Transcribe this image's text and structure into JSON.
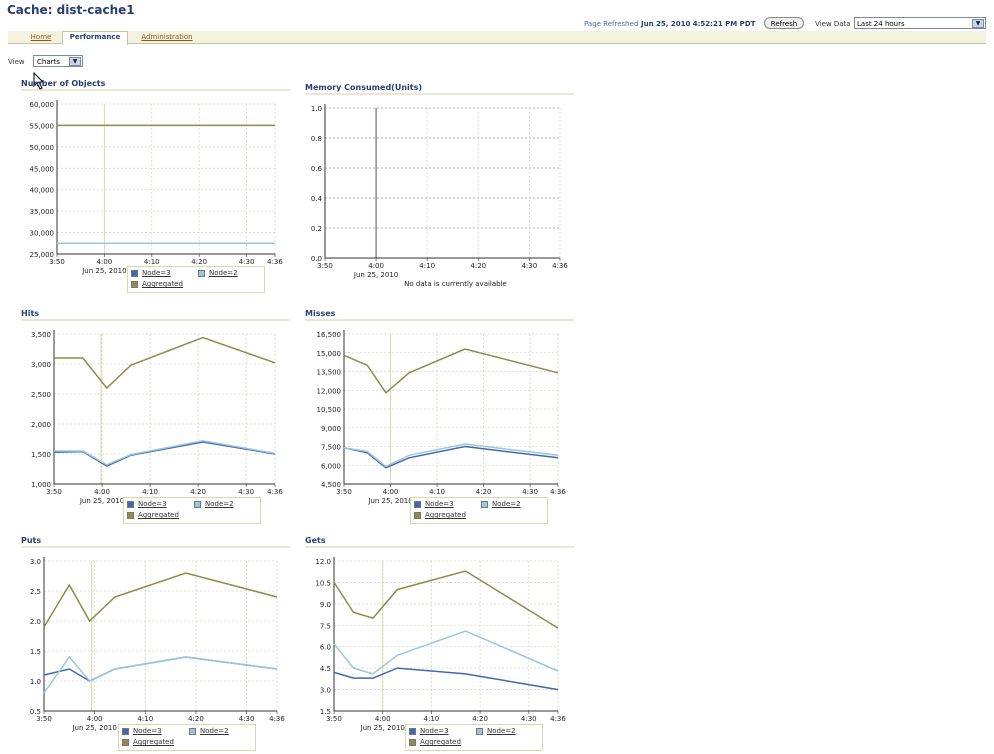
{
  "page_title": "Cache: dist-cache1",
  "header": {
    "refreshed_label": "Page Refreshed",
    "refreshed_time": "Jun 25, 2010 4:52:21 PM PDT",
    "refresh_button": "Refresh",
    "view_data_label": "View Data",
    "view_data_value": "Last 24 hours"
  },
  "tabs": [
    {
      "label": "Home"
    },
    {
      "label": "Performance"
    },
    {
      "label": "Administration"
    }
  ],
  "view": {
    "label": "View",
    "value": "Charts"
  },
  "colors": {
    "node3": "#3f67b5",
    "node2": "#9cc7da",
    "aggregated": "#8e8c48"
  },
  "legend": {
    "node3": "Node=3",
    "node2": "Node=2",
    "aggregated": "Aggregated"
  },
  "chart_data": [
    {
      "type": "line",
      "title": "Number of Objects",
      "x": [
        "3:50",
        "4:00",
        "4:10",
        "4:20",
        "4:30",
        "4:36"
      ],
      "x_date": "Jun 25, 2010",
      "yticks": [
        "60,000",
        "55,000",
        "50,000",
        "45,000",
        "40,000",
        "35,000",
        "30,000",
        "25,000"
      ],
      "ylim": [
        25000,
        60000
      ],
      "series": [
        {
          "name": "Node=3",
          "points": [
            [
              0,
              27500
            ],
            [
              46,
              27500
            ]
          ]
        },
        {
          "name": "Node=2",
          "points": [
            [
              0,
              27500
            ],
            [
              46,
              27500
            ]
          ]
        },
        {
          "name": "Aggregated",
          "points": [
            [
              0,
              55000
            ],
            [
              46,
              55000
            ]
          ]
        }
      ]
    },
    {
      "type": "line",
      "title": "Memory Consumed(Units)",
      "x": [
        "3:50",
        "4:00",
        "4:10",
        "4:20",
        "4:30",
        "4:36"
      ],
      "x_date": "Jun 25, 2010",
      "yticks": [
        "1.0",
        "0.8",
        "0.6",
        "0.4",
        "0.2",
        "0.0"
      ],
      "ylim": [
        0,
        1
      ],
      "no_data": "No data is currently available",
      "series": []
    },
    {
      "type": "line",
      "title": "Hits",
      "x": [
        "3:50",
        "4:00",
        "4:10",
        "4:20",
        "4:30",
        "4:36"
      ],
      "x_date": "Jun 25, 2010",
      "yticks": [
        "3,500",
        "3,000",
        "2,500",
        "2,000",
        "1,500",
        "1,000"
      ],
      "ylim": [
        1000,
        3500
      ],
      "series": [
        {
          "name": "Node=3",
          "points": [
            [
              0,
              1530
            ],
            [
              6,
              1540
            ],
            [
              11,
              1300
            ],
            [
              16,
              1480
            ],
            [
              31,
              1700
            ],
            [
              46,
              1500
            ]
          ]
        },
        {
          "name": "Node=2",
          "points": [
            [
              0,
              1550
            ],
            [
              6,
              1550
            ],
            [
              11,
              1320
            ],
            [
              16,
              1490
            ],
            [
              31,
              1720
            ],
            [
              46,
              1510
            ]
          ]
        },
        {
          "name": "Aggregated",
          "points": [
            [
              0,
              3100
            ],
            [
              6,
              3100
            ],
            [
              11,
              2600
            ],
            [
              16,
              2980
            ],
            [
              31,
              3440
            ],
            [
              46,
              3020
            ]
          ]
        }
      ]
    },
    {
      "type": "line",
      "title": "Misses",
      "x": [
        "3:50",
        "4:00",
        "4:10",
        "4:20",
        "4:30",
        "4:36"
      ],
      "x_date": "Jun 25, 2010",
      "yticks": [
        "16,500",
        "15,000",
        "13,500",
        "12,000",
        "10,500",
        "9,000",
        "7,500",
        "6,000",
        "4,500"
      ],
      "ylim": [
        4500,
        16500
      ],
      "series": [
        {
          "name": "Node=3",
          "points": [
            [
              0,
              7400
            ],
            [
              5,
              7000
            ],
            [
              9,
              5800
            ],
            [
              14,
              6600
            ],
            [
              26,
              7500
            ],
            [
              46,
              6600
            ]
          ]
        },
        {
          "name": "Node=2",
          "points": [
            [
              0,
              7400
            ],
            [
              5,
              7100
            ],
            [
              9,
              5900
            ],
            [
              14,
              6800
            ],
            [
              26,
              7700
            ],
            [
              46,
              6800
            ]
          ]
        },
        {
          "name": "Aggregated",
          "points": [
            [
              0,
              14800
            ],
            [
              5,
              14000
            ],
            [
              9,
              11800
            ],
            [
              14,
              13400
            ],
            [
              26,
              15300
            ],
            [
              46,
              13400
            ]
          ]
        }
      ]
    },
    {
      "type": "line",
      "title": "Puts",
      "x": [
        "3:50",
        "4:00",
        "4:10",
        "4:20",
        "4:30",
        "4:36"
      ],
      "x_date": "Jun 25, 2010",
      "yticks": [
        "3.0",
        "2.5",
        "2.0",
        "1.5",
        "1.0",
        "0.5"
      ],
      "ylim": [
        0.5,
        3.0
      ],
      "series": [
        {
          "name": "Node=3",
          "points": [
            [
              0,
              1.1
            ],
            [
              5,
              1.2
            ],
            [
              9,
              1.0
            ],
            [
              14,
              1.2
            ],
            [
              28,
              1.4
            ],
            [
              46,
              1.2
            ]
          ]
        },
        {
          "name": "Node=2",
          "points": [
            [
              0,
              0.8
            ],
            [
              5,
              1.4
            ],
            [
              9,
              1.0
            ],
            [
              14,
              1.2
            ],
            [
              28,
              1.4
            ],
            [
              46,
              1.2
            ]
          ]
        },
        {
          "name": "Aggregated",
          "points": [
            [
              0,
              1.9
            ],
            [
              5,
              2.6
            ],
            [
              9,
              2.0
            ],
            [
              14,
              2.4
            ],
            [
              28,
              2.8
            ],
            [
              46,
              2.4
            ]
          ]
        }
      ]
    },
    {
      "type": "line",
      "title": "Gets",
      "x": [
        "3:50",
        "4:00",
        "4:10",
        "4:20",
        "4:30",
        "4:36"
      ],
      "x_date": "Jun 25, 2010",
      "yticks": [
        "12.0",
        "10.5",
        "9.0",
        "7.5",
        "6.0",
        "4.5",
        "3.0",
        "1.5"
      ],
      "ylim": [
        1.5,
        12.0
      ],
      "series": [
        {
          "name": "Node=3",
          "points": [
            [
              0,
              4.2
            ],
            [
              4,
              3.8
            ],
            [
              8,
              3.8
            ],
            [
              13,
              4.5
            ],
            [
              27,
              4.1
            ],
            [
              46,
              3.0
            ]
          ]
        },
        {
          "name": "Node=2",
          "points": [
            [
              0,
              6.2
            ],
            [
              4,
              4.5
            ],
            [
              8,
              4.1
            ],
            [
              13,
              5.4
            ],
            [
              27,
              7.1
            ],
            [
              46,
              4.3
            ]
          ]
        },
        {
          "name": "Aggregated",
          "points": [
            [
              0,
              10.5
            ],
            [
              4,
              8.4
            ],
            [
              8,
              8.0
            ],
            [
              13,
              10.0
            ],
            [
              27,
              11.3
            ],
            [
              46,
              7.3
            ]
          ]
        }
      ]
    }
  ]
}
